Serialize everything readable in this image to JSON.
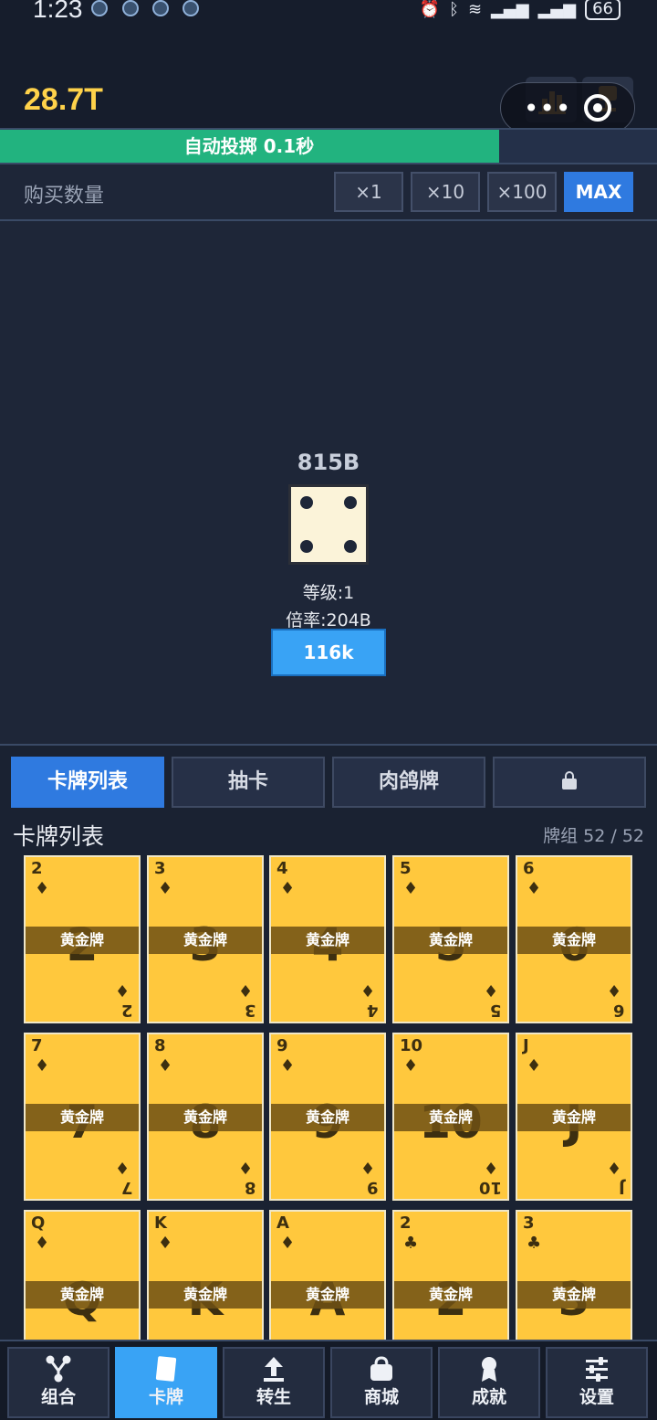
{
  "status_bar": {
    "time": "1:23",
    "battery": "66"
  },
  "header": {
    "money": "28.7T"
  },
  "auto_roll": {
    "label": "自动投掷 0.1秒",
    "progress": 0.76
  },
  "buy": {
    "label": "购买数量",
    "options": [
      "×1",
      "×10",
      "×100",
      "MAX"
    ],
    "selected": "MAX"
  },
  "dice": {
    "value": "815B",
    "face": 4,
    "level": "等级:1",
    "rate": "倍率:204B",
    "upgrade_cost": "116k"
  },
  "tabs": {
    "items": [
      "卡牌列表",
      "抽卡",
      "肉鸽牌",
      ""
    ],
    "active": "卡牌列表"
  },
  "card_list": {
    "title": "卡牌列表",
    "deck_count": "牌组 52 / 52",
    "cards": [
      {
        "rank": "2",
        "suit": "♦",
        "tier": "黄金牌"
      },
      {
        "rank": "3",
        "suit": "♦",
        "tier": "黄金牌"
      },
      {
        "rank": "4",
        "suit": "♦",
        "tier": "黄金牌"
      },
      {
        "rank": "5",
        "suit": "♦",
        "tier": "黄金牌"
      },
      {
        "rank": "6",
        "suit": "♦",
        "tier": "黄金牌"
      },
      {
        "rank": "7",
        "suit": "♦",
        "tier": "黄金牌"
      },
      {
        "rank": "8",
        "suit": "♦",
        "tier": "黄金牌"
      },
      {
        "rank": "9",
        "suit": "♦",
        "tier": "黄金牌"
      },
      {
        "rank": "10",
        "suit": "♦",
        "tier": "黄金牌"
      },
      {
        "rank": "J",
        "suit": "♦",
        "tier": "黄金牌"
      },
      {
        "rank": "Q",
        "suit": "♦",
        "tier": "黄金牌"
      },
      {
        "rank": "K",
        "suit": "♦",
        "tier": "黄金牌"
      },
      {
        "rank": "A",
        "suit": "♦",
        "tier": "黄金牌"
      },
      {
        "rank": "2",
        "suit": "♣",
        "tier": "黄金牌"
      },
      {
        "rank": "3",
        "suit": "♣",
        "tier": "黄金牌"
      }
    ]
  },
  "bottom_nav": {
    "items": [
      {
        "label": "组合",
        "icon": "combo-icon"
      },
      {
        "label": "卡牌",
        "icon": "card-icon"
      },
      {
        "label": "转生",
        "icon": "rebirth-icon"
      },
      {
        "label": "商城",
        "icon": "shop-icon"
      },
      {
        "label": "成就",
        "icon": "achievement-icon"
      },
      {
        "label": "设置",
        "icon": "settings-icon"
      }
    ],
    "active": "卡牌"
  },
  "colors": {
    "background": "#1e2638",
    "money": "#ffd24a",
    "progress": "#22b37f",
    "accent": "#2f7ae0",
    "upgrade": "#39a3f5",
    "card": "#ffc83d"
  }
}
